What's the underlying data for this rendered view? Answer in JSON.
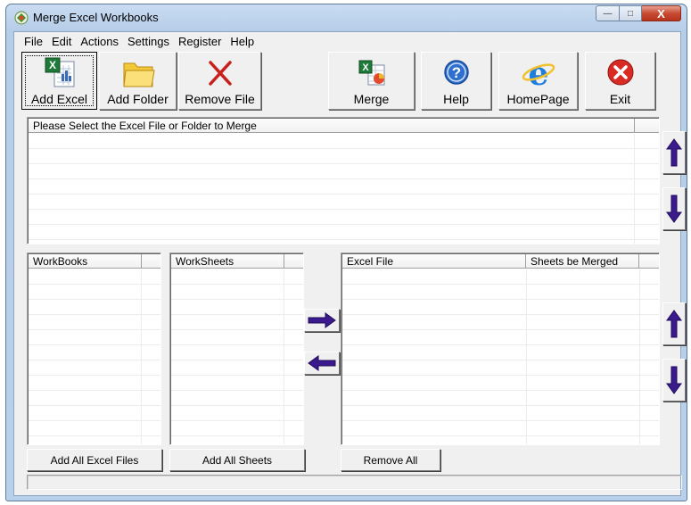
{
  "window": {
    "title": "Merge Excel Workbooks",
    "minimize": "—",
    "maximize": "□",
    "close": "X"
  },
  "menu": [
    "File",
    "Edit",
    "Actions",
    "Settings",
    "Register",
    "Help"
  ],
  "toolbar": {
    "add_excel": "Add Excel",
    "add_folder": "Add Folder",
    "remove_file": "Remove File",
    "merge": "Merge",
    "help": "Help",
    "homepage": "HomePage",
    "exit": "Exit"
  },
  "file_list": {
    "header": "Please Select the Excel File or Folder to Merge"
  },
  "workbooks": {
    "header": "WorkBooks"
  },
  "worksheets": {
    "header": "WorkSheets"
  },
  "merge_list": {
    "col_excel_file": "Excel File",
    "col_sheets": "Sheets be Merged"
  },
  "buttons": {
    "add_all_excel": "Add All Excel Files",
    "add_all_sheets": "Add All Sheets",
    "remove_all": "Remove All"
  },
  "colors": {
    "arrow": "#3a1a8c",
    "title_bar": "#c9dcf2",
    "client_bg": "#f0f0f0"
  },
  "icons": {
    "app": "merge-app-icon",
    "add_excel": "excel-file-icon",
    "add_folder": "folder-icon",
    "remove_file": "red-x-icon",
    "merge": "merge-excel-icon",
    "help": "question-icon",
    "homepage": "internet-explorer-icon",
    "exit": "exit-icon"
  }
}
